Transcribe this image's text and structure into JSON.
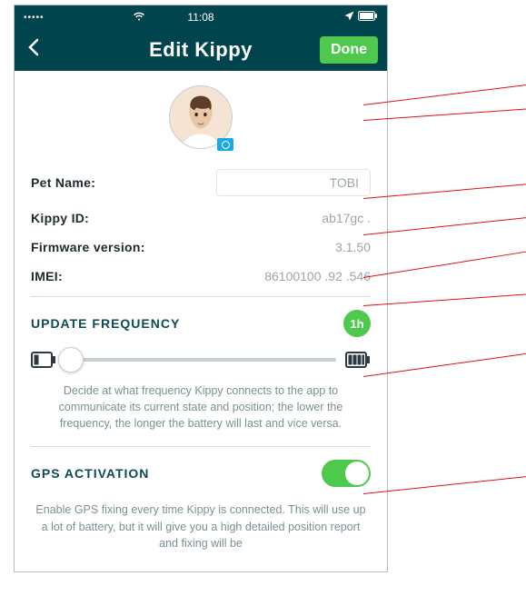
{
  "status_bar": {
    "signal": "•••••",
    "time": "11:08"
  },
  "nav": {
    "title": "Edit Kippy",
    "done": "Done"
  },
  "fields": {
    "pet_name_label": "Pet Name:",
    "pet_name_value": "TOBI",
    "kippy_id_label": "Kippy ID:",
    "kippy_id_value": "ab17gc .",
    "firmware_label": "Firmware version:",
    "firmware_value": "3.1.50",
    "imei_label": "IMEI:",
    "imei_value": "86100100 .92 .546"
  },
  "update_freq": {
    "title": "UPDATE FREQUENCY",
    "badge": "1h",
    "help": "Decide at what frequency Kippy connects to the app to communicate its current state and position; the lower the frequency, the longer the battery will last and vice versa."
  },
  "gps": {
    "title": "GPS ACTIVATION",
    "help": "Enable GPS fixing every time Kippy is connected. This will use up a lot of battery, but it will give you a high detailed position report and fixing will be"
  }
}
